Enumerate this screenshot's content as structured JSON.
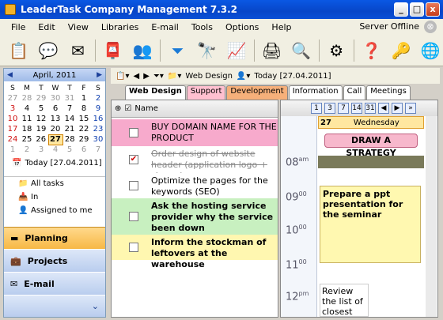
{
  "window": {
    "title": "LeaderTask Company Management 7.3.2",
    "min": "_",
    "max": "□",
    "close": "x"
  },
  "menu": [
    "File",
    "Edit",
    "View",
    "Libraries",
    "E-mail",
    "Tools",
    "Options",
    "Help"
  ],
  "server_status": "Server Offline",
  "calendar": {
    "month_label": "April, 2011",
    "dow": [
      "S",
      "M",
      "T",
      "W",
      "T",
      "F",
      "S"
    ],
    "weeks": [
      [
        "27",
        "28",
        "29",
        "30",
        "31",
        "1",
        "2"
      ],
      [
        "3",
        "4",
        "5",
        "6",
        "7",
        "8",
        "9"
      ],
      [
        "10",
        "11",
        "12",
        "13",
        "14",
        "15",
        "16"
      ],
      [
        "17",
        "18",
        "19",
        "20",
        "21",
        "22",
        "23"
      ],
      [
        "24",
        "25",
        "26",
        "27",
        "28",
        "29",
        "30"
      ],
      [
        "1",
        "2",
        "3",
        "4",
        "5",
        "6",
        "7"
      ]
    ],
    "today_label": "Today [27.04.2011]"
  },
  "tasklist": [
    "All tasks",
    "In",
    "Assigned to me"
  ],
  "nav": {
    "planning": "Planning",
    "projects": "Projects",
    "email": "E-mail"
  },
  "nav_toolbar": {
    "filter": "Web Design",
    "date": "Today [27.04.2011]"
  },
  "tabs": [
    "Web Design",
    "Support",
    "Development",
    "Information",
    "Call",
    "Meetings"
  ],
  "tab_colors": [
    "#ffffff",
    "#ffc0d0",
    "#f6b07a",
    "#ffffff",
    "#ffffff",
    "#ffffff"
  ],
  "tasks_header": "Name",
  "tasks": [
    {
      "text": "BUY DOMAIN NAME FOR THE PRODUCT",
      "bg": "#f7aacc",
      "checked": false,
      "bold": false
    },
    {
      "text": "Order design of website header (application logo + slogan)",
      "bg": "#ffffff",
      "checked": true,
      "done": true
    },
    {
      "text": "Optimize the pages for the keywords (SEO)",
      "bg": "#ffffff",
      "checked": false
    },
    {
      "text": "Ask the hosting service provider why the service been down",
      "bg": "#c8f0c0",
      "checked": false,
      "bold": true
    },
    {
      "text": "Inform the stockman of leftovers at the warehouse",
      "bg": "#fff7b0",
      "checked": false,
      "bold": true
    }
  ],
  "schedule": {
    "view_buttons": [
      "1",
      "3",
      "7",
      "14",
      "31"
    ],
    "day_number": "27",
    "day_name": "Wednesday",
    "times": [
      "08",
      "09",
      "10",
      "11",
      "12"
    ],
    "am": "am",
    "pm": "pm",
    "event_banner": "DRAW A STRATEGY",
    "note": "Prepare a ppt presentation for the seminar",
    "note2": "Review the list of closest"
  }
}
